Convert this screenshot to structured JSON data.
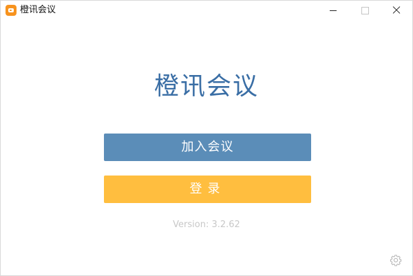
{
  "window": {
    "title": "橙讯会议",
    "icons": {
      "app": "video-camera-app-icon",
      "minimize": "minimize-icon",
      "maximize": "maximize-icon",
      "close": "close-icon",
      "settings": "gear-icon"
    }
  },
  "main": {
    "title": "橙讯会议",
    "join_label": "加入会议",
    "login_label": "登录",
    "version": "Version: 3.2.62"
  },
  "colors": {
    "title": "#3a6ea5",
    "join_button": "#5b8db8",
    "login_button": "#ffbe3f",
    "version_text": "#c8c8c8",
    "app_icon": "#f7931e"
  }
}
